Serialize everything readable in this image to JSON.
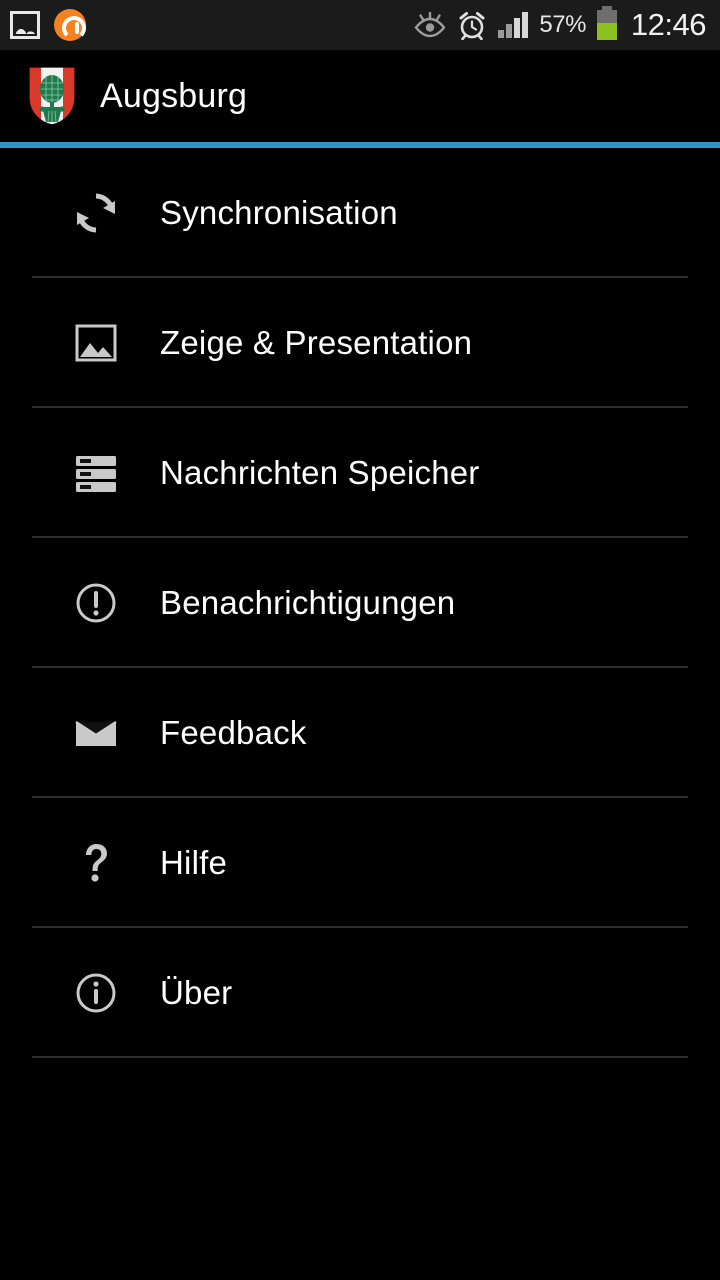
{
  "status_bar": {
    "notification_icons": [
      {
        "name": "photo-screenshot-icon",
        "label": "Screenshot captured"
      },
      {
        "name": "orange-app-icon",
        "label": "App notification"
      }
    ],
    "system_icons": [
      {
        "name": "smart-stay-eye-icon",
        "label": "Smart stay"
      },
      {
        "name": "alarm-clock-icon",
        "label": "Alarm set"
      },
      {
        "name": "signal-bars-icon",
        "label": "Signal strength"
      }
    ],
    "battery_percent": "57%",
    "battery_level": 57,
    "clock": "12:46",
    "signal_bars_total": 4,
    "signal_bars_active": 2
  },
  "action_bar": {
    "logo_icon": "augsburg-coat-of-arms-icon",
    "title": "Augsburg",
    "accent_color": "#2f93c8",
    "logo_colors": {
      "shield_red": "#d8392b",
      "shield_white": "#f2f2f2",
      "pinecone_green": "#1f7a4d"
    }
  },
  "settings_list": {
    "items": [
      {
        "icon": "sync-refresh-icon",
        "label": "Synchronisation"
      },
      {
        "icon": "image-gallery-icon",
        "label": "Zeige & Presentation"
      },
      {
        "icon": "storage-database-icon",
        "label": "Nachrichten Speicher"
      },
      {
        "icon": "alert-exclamation-circle-icon",
        "label": "Benachrichtigungen"
      },
      {
        "icon": "envelope-mail-icon",
        "label": "Feedback"
      },
      {
        "icon": "question-mark-icon",
        "label": "Hilfe"
      },
      {
        "icon": "info-circle-icon",
        "label": "Über"
      }
    ]
  },
  "theme": {
    "background": "#000000",
    "status_bar_background": "#1b1b1b",
    "text_primary": "#ffffff",
    "icon_tint": "#c9c9c9",
    "divider": "#2e2e2e"
  }
}
